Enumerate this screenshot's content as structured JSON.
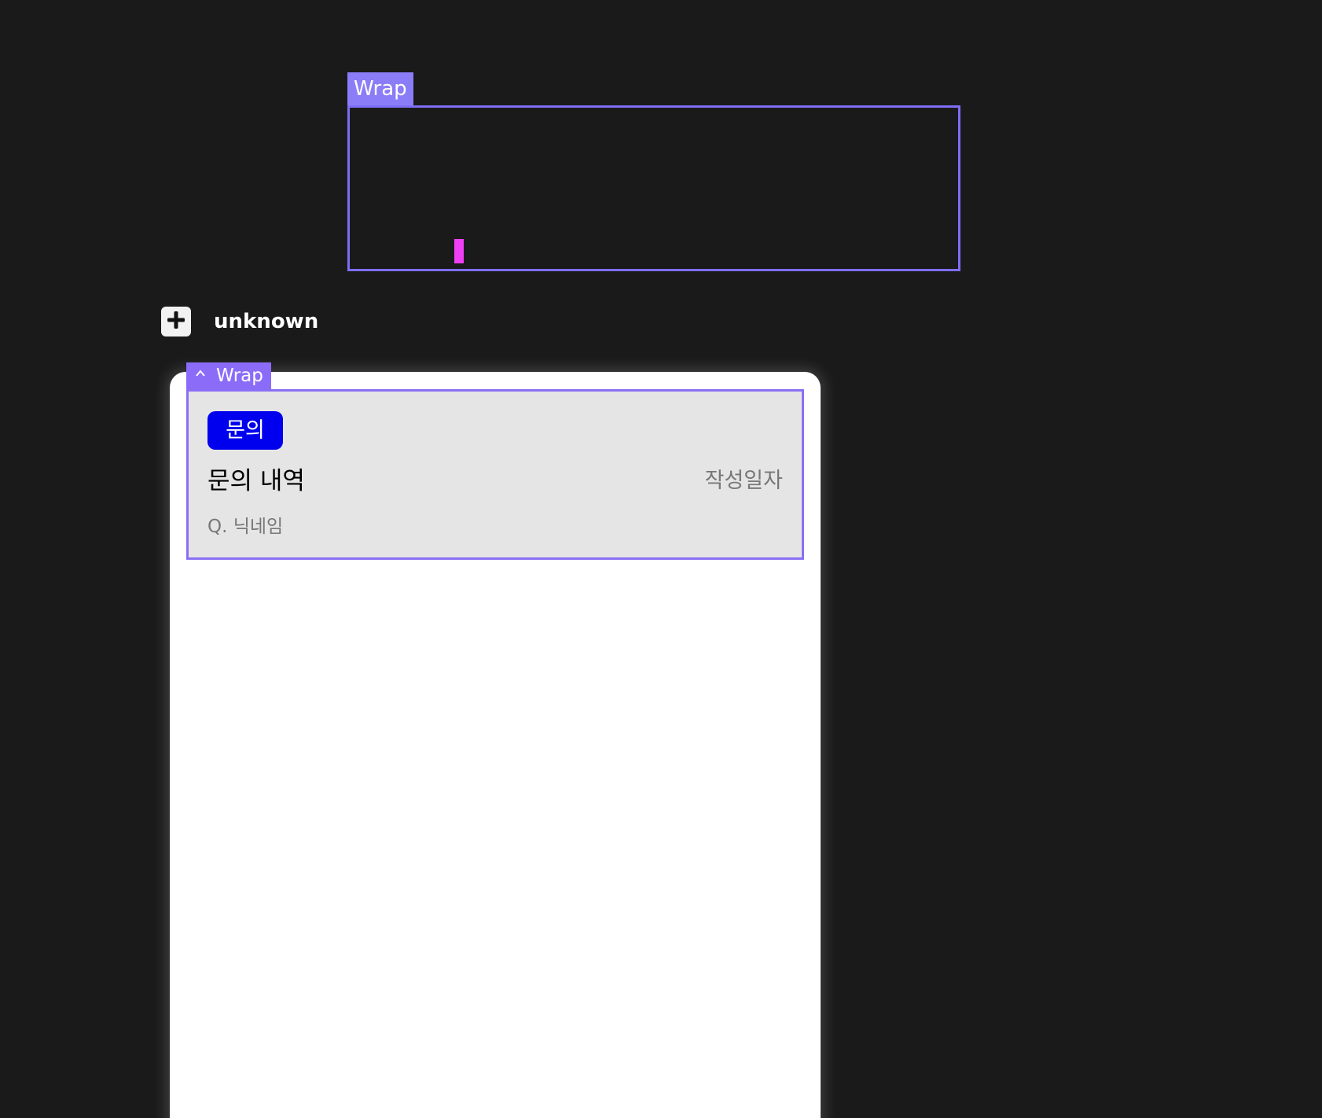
{
  "top_frame": {
    "label": "Wrap",
    "frame_color": "#7e6ef5",
    "marker_color": "#ee3ff5"
  },
  "layer": {
    "name": "unknown",
    "add_icon": "plus-icon"
  },
  "component": {
    "tag_label": "Wrap",
    "tag_icon": "chevron-up-icon",
    "badge_label": "문의",
    "badge_color": "#0000ee",
    "title": "문의 내역",
    "date_label": "작성일자",
    "nickname": "Q. 닉네임"
  }
}
